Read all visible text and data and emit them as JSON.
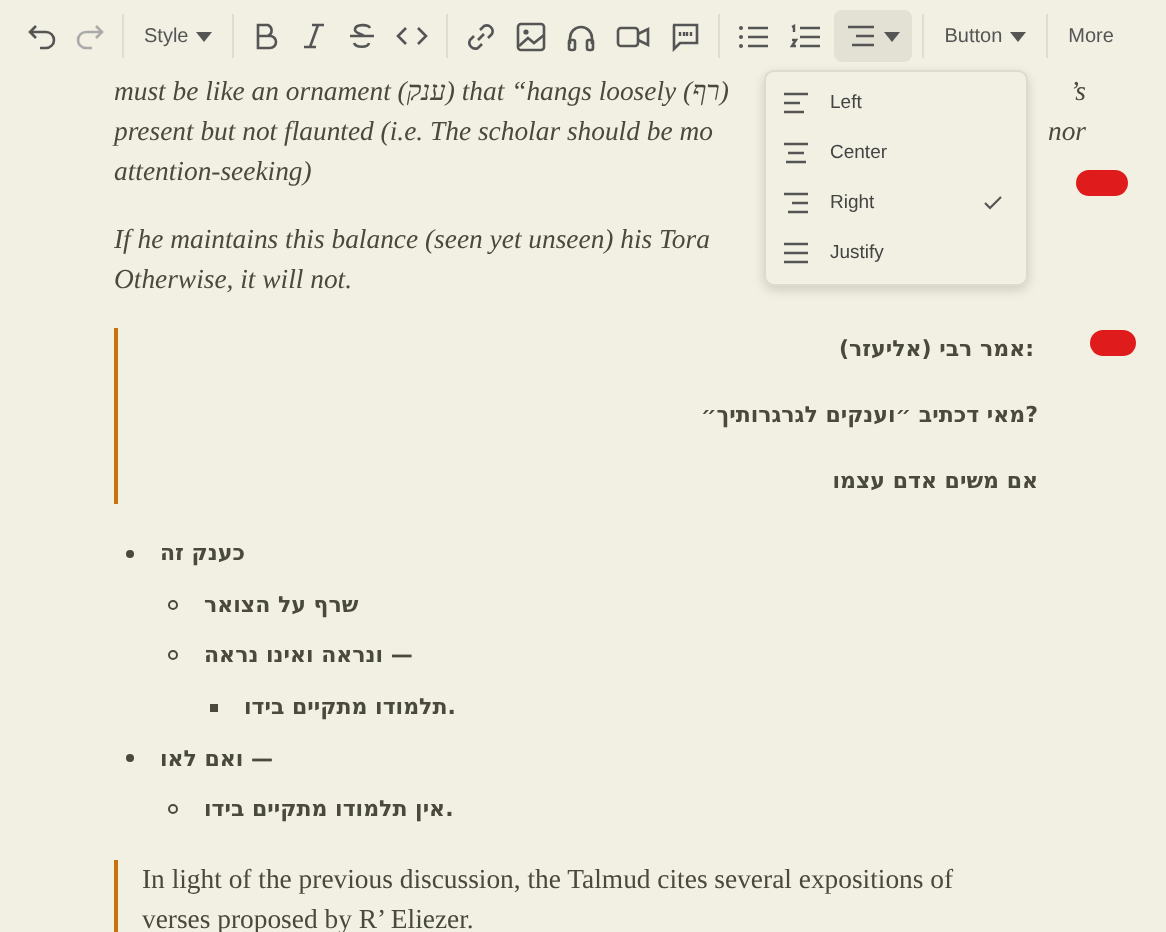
{
  "toolbar": {
    "undo": {
      "disabled": false
    },
    "redo": {
      "disabled": true
    },
    "style_menu": {
      "label": "Style"
    },
    "align_menu": {
      "open": true
    },
    "button_menu": {
      "label": "Button"
    },
    "more": {
      "label": "More"
    }
  },
  "align_options": [
    {
      "label": "Left",
      "selected": false
    },
    {
      "label": "Center",
      "selected": false
    },
    {
      "label": "Right",
      "selected": true
    },
    {
      "label": "Justify",
      "selected": false
    }
  ],
  "content": [
    {
      "kind": "paragraph",
      "lines": [
        {
          "left": "must be like an ornament (ענק) that “hangs loosely (רף)",
          "right": "’s"
        },
        {
          "left": "present but not flaunted (i.e. The scholar should be mo",
          "right": "nor"
        },
        {
          "left": "attention-seeking)"
        }
      ]
    },
    {
      "kind": "paragraph",
      "lines": [
        {
          "left": "If he maintains this balance (seen yet unseen) his Tora"
        },
        {
          "left": "Otherwise, it will not."
        }
      ]
    },
    {
      "kind": "rtl_quote",
      "lines": [
        "אמר רבי (אליעזר):",
        "מאי דכתיב ״וענקים לגרגרותיך״?",
        "אם משים אדם עצמו"
      ]
    },
    {
      "kind": "list",
      "items": [
        {
          "text": "כענק זה",
          "children": [
            {
              "text": "שרף על הצואר"
            },
            {
              "text": "ונראה ואינו נראה —",
              "children": [
                {
                  "text": "תלמודו מתקיים בידו."
                }
              ]
            }
          ]
        },
        {
          "text": "ואם לאו —",
          "children": [
            {
              "text": "אין תלמודו מתקיים בידו."
            }
          ]
        }
      ]
    },
    {
      "kind": "quote",
      "text": "In light of the previous discussion, the Talmud cites several expositions of verses proposed by R’ Eliezer."
    }
  ]
}
